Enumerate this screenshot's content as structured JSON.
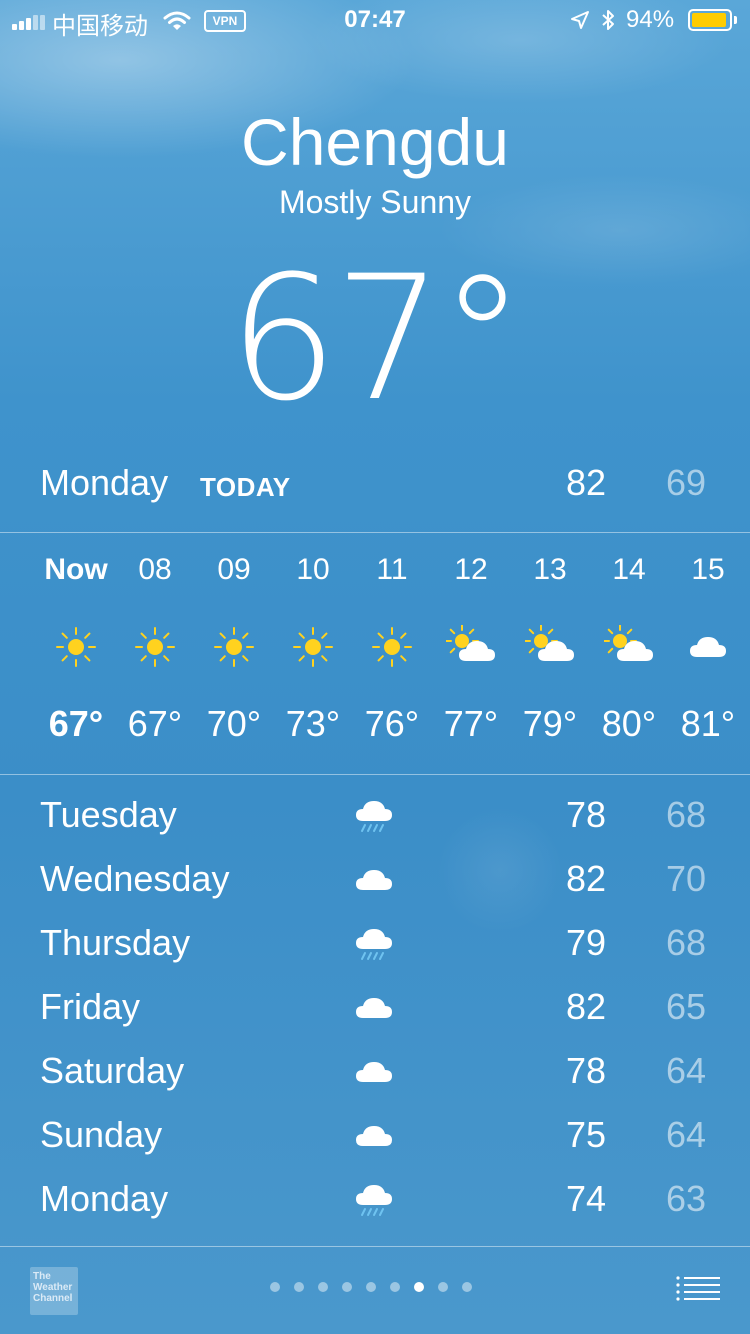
{
  "status_bar": {
    "carrier": "中国移动",
    "vpn_label": "VPN",
    "time": "07:47",
    "battery_percent": "94%",
    "battery_level": 0.94,
    "battery_color": "#ffcc00",
    "icons": [
      "signal-icon",
      "wifi-icon",
      "location-arrow-icon",
      "bluetooth-icon",
      "battery-icon"
    ]
  },
  "header": {
    "city": "Chengdu",
    "condition": "Mostly Sunny",
    "temperature": "67°"
  },
  "today": {
    "day": "Monday",
    "label": "TODAY",
    "high": "82",
    "low": "69"
  },
  "hourly": [
    {
      "hour": "Now",
      "icon": "sun-icon",
      "temp": "67°"
    },
    {
      "hour": "08",
      "icon": "sun-icon",
      "temp": "67°"
    },
    {
      "hour": "09",
      "icon": "sun-icon",
      "temp": "70°"
    },
    {
      "hour": "10",
      "icon": "sun-icon",
      "temp": "73°"
    },
    {
      "hour": "11",
      "icon": "sun-icon",
      "temp": "76°"
    },
    {
      "hour": "12",
      "icon": "partly-cloudy-icon",
      "temp": "77°"
    },
    {
      "hour": "13",
      "icon": "partly-cloudy-icon",
      "temp": "79°"
    },
    {
      "hour": "14",
      "icon": "partly-cloudy-icon",
      "temp": "80°"
    },
    {
      "hour": "15",
      "icon": "cloud-icon",
      "temp": "81°"
    }
  ],
  "daily": [
    {
      "day": "Tuesday",
      "icon": "rain-icon",
      "high": "78",
      "low": "68"
    },
    {
      "day": "Wednesday",
      "icon": "cloud-icon",
      "high": "82",
      "low": "70"
    },
    {
      "day": "Thursday",
      "icon": "rain-icon",
      "high": "79",
      "low": "68"
    },
    {
      "day": "Friday",
      "icon": "cloud-icon",
      "high": "82",
      "low": "65"
    },
    {
      "day": "Saturday",
      "icon": "cloud-icon",
      "high": "78",
      "low": "64"
    },
    {
      "day": "Sunday",
      "icon": "cloud-icon",
      "high": "75",
      "low": "64"
    },
    {
      "day": "Monday",
      "icon": "rain-icon",
      "high": "74",
      "low": "63"
    }
  ],
  "footer": {
    "logo_text": "The Weather Channel",
    "page_count": 9,
    "active_page": 7
  },
  "colors": {
    "sun": "#ffd21f",
    "sun_rays": "#ffd21f",
    "cloud": "#ffffff",
    "rain_drops": "#6fc3f0",
    "low_temp_text": "rgba(255,255,255,0.55)"
  }
}
